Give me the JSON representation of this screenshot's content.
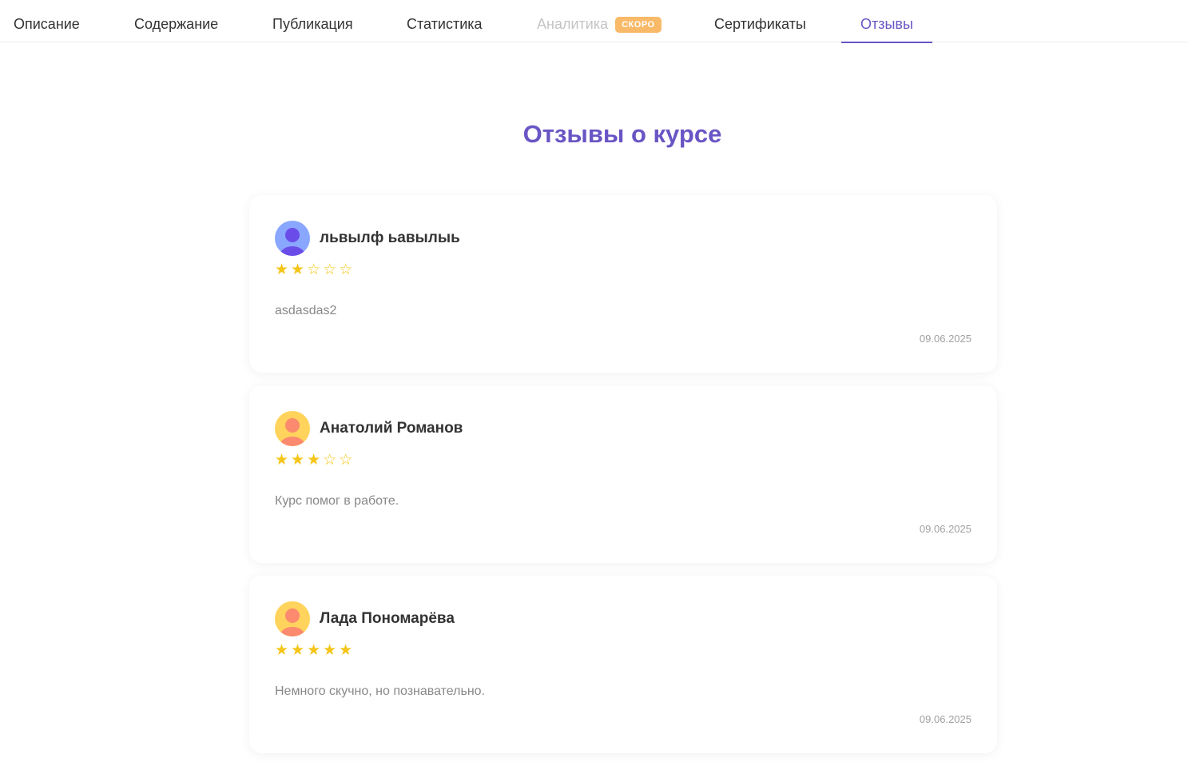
{
  "tabs": [
    {
      "label": "Описание",
      "state": "default"
    },
    {
      "label": "Содержание",
      "state": "default"
    },
    {
      "label": "Публикация",
      "state": "default"
    },
    {
      "label": "Статистика",
      "state": "default"
    },
    {
      "label": "Аналитика",
      "state": "disabled",
      "badge": "СКОРО"
    },
    {
      "label": "Сертификаты",
      "state": "default"
    },
    {
      "label": "Отзывы",
      "state": "active"
    }
  ],
  "page_title": "Отзывы о курсе",
  "reviews": [
    {
      "author": "львылф ьавылыь",
      "rating": 2,
      "rating_max": 5,
      "stars": "★★☆☆☆",
      "text": "asdasdas2",
      "date": "09.06.2025",
      "avatar_icon": "user-avatar-icon",
      "avatar_colors": {
        "bg": "#8aa7ff",
        "figure": "#6a4de8"
      }
    },
    {
      "author": "Анатолий Романов",
      "rating": 3,
      "rating_max": 5,
      "stars": "★★★☆☆",
      "text": "Курс помог в работе.",
      "date": "09.06.2025",
      "avatar_icon": "user-avatar-icon",
      "avatar_colors": {
        "bg": "#ffd35c",
        "figure": "#fb8a6e"
      }
    },
    {
      "author": "Лада Пономарёва",
      "rating": 5,
      "rating_max": 5,
      "stars": "★★★★★",
      "text": "Немного скучно, но познавательно.",
      "date": "09.06.2025",
      "avatar_icon": "user-avatar-icon",
      "avatar_colors": {
        "bg": "#ffd35c",
        "figure": "#fb8a6e"
      }
    }
  ],
  "colors": {
    "accent": "#6a55c4",
    "badge": "#f8b968",
    "star": "#f5c518",
    "text_muted": "#888888"
  }
}
